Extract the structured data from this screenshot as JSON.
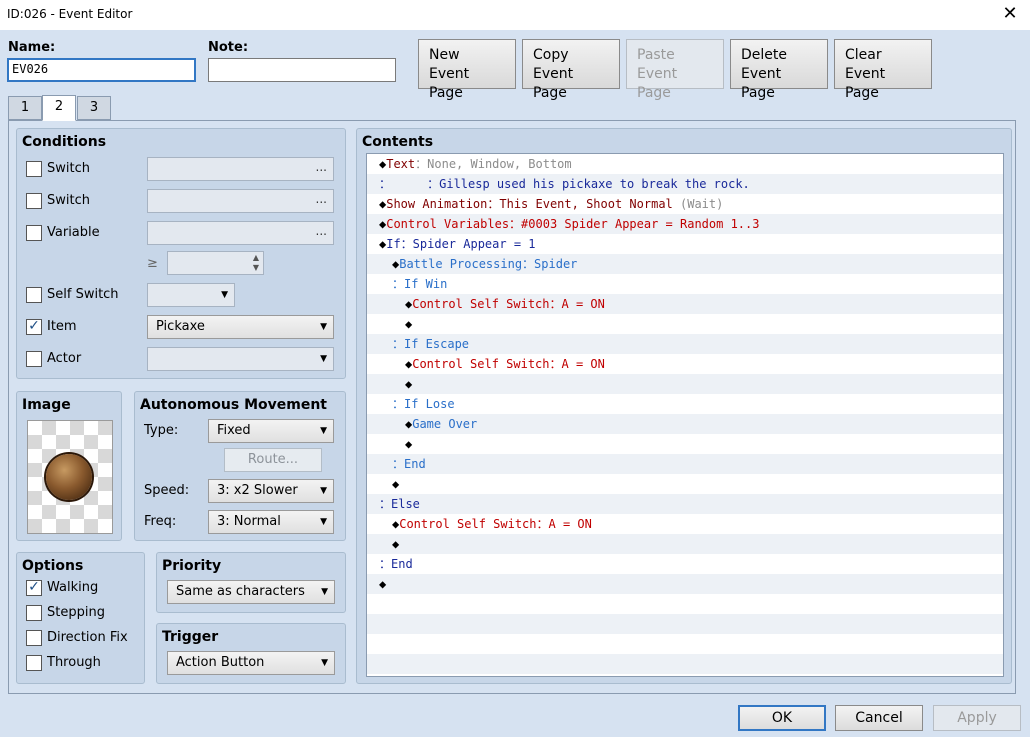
{
  "window": {
    "title": "ID:026 - Event Editor",
    "close_glyph": "✕"
  },
  "header": {
    "name_label": "Name:",
    "name_value": "EV026",
    "note_label": "Note:",
    "note_value": ""
  },
  "page_buttons": [
    {
      "line1": "New",
      "line2": "Event Page"
    },
    {
      "line1": "Copy",
      "line2": "Event Page"
    },
    {
      "line1": "Paste",
      "line2": "Event Page"
    },
    {
      "line1": "Delete",
      "line2": "Event Page"
    },
    {
      "line1": "Clear",
      "line2": "Event Page"
    }
  ],
  "tabs": [
    "1",
    "2",
    "3"
  ],
  "conditions": {
    "title": "Conditions",
    "switch1_label": "Switch",
    "switch2_label": "Switch",
    "variable_label": "Variable",
    "ge_symbol": "≥",
    "self_switch_label": "Self Switch",
    "item_label": "Item",
    "item_value": "Pickaxe",
    "actor_label": "Actor",
    "dots": "..."
  },
  "image": {
    "title": "Image"
  },
  "movement": {
    "title": "Autonomous Movement",
    "type_label": "Type:",
    "type_value": "Fixed",
    "route_label": "Route...",
    "speed_label": "Speed:",
    "speed_value": "3: x2 Slower",
    "freq_label": "Freq:",
    "freq_value": "3: Normal"
  },
  "options": {
    "title": "Options",
    "walking": "Walking",
    "stepping": "Stepping",
    "direction_fix": "Direction Fix",
    "through": "Through"
  },
  "priority": {
    "title": "Priority",
    "value": "Same as characters"
  },
  "trigger": {
    "title": "Trigger",
    "value": "Action Button"
  },
  "contents": {
    "title": "Contents",
    "rows": [
      {
        "indent": 0,
        "parts": [
          {
            "t": "◆",
            "c": ""
          },
          {
            "t": "Text",
            "c": "c-dred"
          },
          {
            "t": "：None, Window, Bottom",
            "c": "c-gray"
          }
        ]
      },
      {
        "indent": 0,
        "parts": [
          {
            "t": "：     ：",
            "c": "c-navy"
          },
          {
            "t": "Gillesp used his pickaxe to break the rock.",
            "c": "c-navy"
          }
        ]
      },
      {
        "indent": 0,
        "parts": [
          {
            "t": "◆",
            "c": ""
          },
          {
            "t": "Show Animation：This Event, Shoot Normal ",
            "c": "c-dred"
          },
          {
            "t": "(Wait)",
            "c": "c-gray"
          }
        ]
      },
      {
        "indent": 0,
        "parts": [
          {
            "t": "◆",
            "c": ""
          },
          {
            "t": "Control Variables：#0003 Spider Appear = Random 1..3",
            "c": "c-red"
          }
        ]
      },
      {
        "indent": 0,
        "parts": [
          {
            "t": "◆",
            "c": ""
          },
          {
            "t": "If：Spider Appear = 1",
            "c": "c-navy"
          }
        ]
      },
      {
        "indent": 1,
        "parts": [
          {
            "t": "◆",
            "c": ""
          },
          {
            "t": "Battle Processing：Spider",
            "c": "c-blue"
          }
        ]
      },
      {
        "indent": 1,
        "parts": [
          {
            "t": "：If Win",
            "c": "c-blue"
          }
        ]
      },
      {
        "indent": 2,
        "parts": [
          {
            "t": "◆",
            "c": ""
          },
          {
            "t": "Control Self Switch：A = ON",
            "c": "c-red"
          }
        ]
      },
      {
        "indent": 2,
        "parts": [
          {
            "t": "◆",
            "c": ""
          }
        ]
      },
      {
        "indent": 1,
        "parts": [
          {
            "t": "：If Escape",
            "c": "c-blue"
          }
        ]
      },
      {
        "indent": 2,
        "parts": [
          {
            "t": "◆",
            "c": ""
          },
          {
            "t": "Control Self Switch：A = ON",
            "c": "c-red"
          }
        ]
      },
      {
        "indent": 2,
        "parts": [
          {
            "t": "◆",
            "c": ""
          }
        ]
      },
      {
        "indent": 1,
        "parts": [
          {
            "t": "：If Lose",
            "c": "c-blue"
          }
        ]
      },
      {
        "indent": 2,
        "parts": [
          {
            "t": "◆",
            "c": ""
          },
          {
            "t": "Game Over",
            "c": "c-blue"
          }
        ]
      },
      {
        "indent": 2,
        "parts": [
          {
            "t": "◆",
            "c": ""
          }
        ]
      },
      {
        "indent": 1,
        "parts": [
          {
            "t": "：End",
            "c": "c-blue"
          }
        ]
      },
      {
        "indent": 1,
        "parts": [
          {
            "t": "◆",
            "c": ""
          }
        ]
      },
      {
        "indent": 0,
        "parts": [
          {
            "t": "：Else",
            "c": "c-navy"
          }
        ]
      },
      {
        "indent": 1,
        "parts": [
          {
            "t": "◆",
            "c": ""
          },
          {
            "t": "Control Self Switch：A = ON",
            "c": "c-red"
          }
        ]
      },
      {
        "indent": 1,
        "parts": [
          {
            "t": "◆",
            "c": ""
          }
        ]
      },
      {
        "indent": 0,
        "parts": [
          {
            "t": "：End",
            "c": "c-navy"
          }
        ]
      },
      {
        "indent": 0,
        "parts": [
          {
            "t": "◆",
            "c": ""
          }
        ]
      },
      {
        "indent": 0,
        "parts": []
      },
      {
        "indent": 0,
        "parts": []
      },
      {
        "indent": 0,
        "parts": []
      },
      {
        "indent": 0,
        "parts": []
      }
    ]
  },
  "footer": {
    "ok": "OK",
    "cancel": "Cancel",
    "apply": "Apply"
  }
}
